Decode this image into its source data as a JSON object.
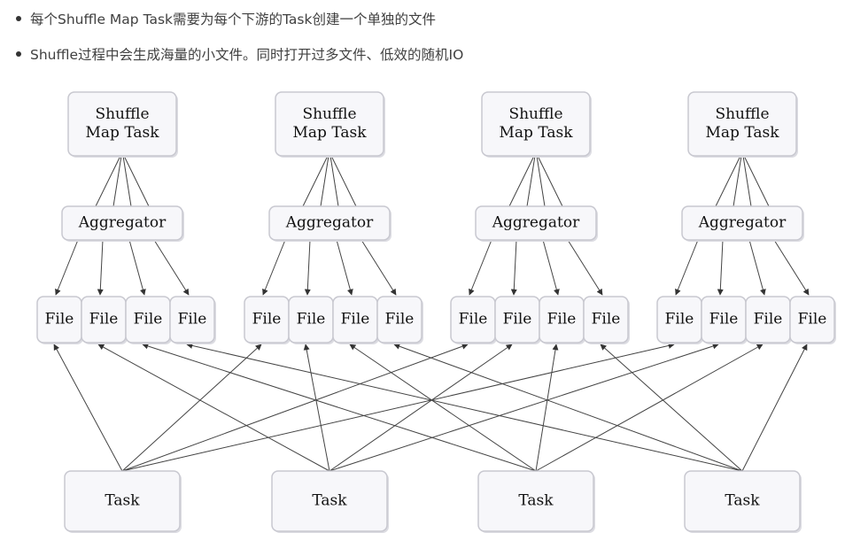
{
  "bullets": [
    "每个Shuffle Map Task需要为每个下游的Task创建一个单独的文件",
    "Shuffle过程中会生成海量的小文件。同时打开过多文件、低效的随机IO"
  ],
  "diagram": {
    "map_task_label_line1": "Shuffle",
    "map_task_label_line2": "Map Task",
    "aggregator_label": "Aggregator",
    "file_label": "File",
    "task_label": "Task",
    "map_task_count": 4,
    "files_per_group": 4,
    "downstream_task_count": 4
  }
}
